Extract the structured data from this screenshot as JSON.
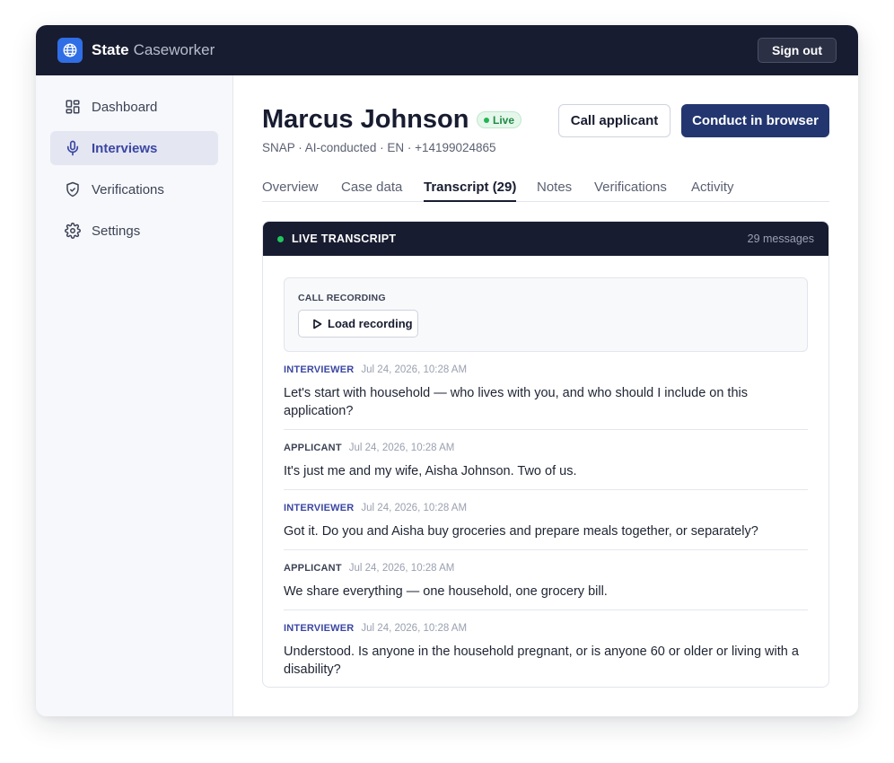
{
  "app": {
    "brand_bold": "State",
    "brand_light": "Caseworker",
    "sign_out": "Sign out"
  },
  "sidebar": {
    "items": [
      {
        "label": "Dashboard",
        "icon": "dashboard-icon",
        "active": false
      },
      {
        "label": "Interviews",
        "icon": "microphone-icon",
        "active": true
      },
      {
        "label": "Verifications",
        "icon": "shield-check-icon",
        "active": false
      },
      {
        "label": "Settings",
        "icon": "gear-icon",
        "active": false
      }
    ]
  },
  "applicant": {
    "name": "Marcus Johnson",
    "status": "Live",
    "details": "SNAP · AI-conducted · EN · +14199024865"
  },
  "actions": {
    "call": "Call applicant",
    "conduct": "Conduct in browser"
  },
  "tabs": [
    {
      "label": "Overview",
      "active": false
    },
    {
      "label": "Case data",
      "active": false
    },
    {
      "label": "Transcript (29)",
      "active": true
    },
    {
      "label": "Notes",
      "active": false
    },
    {
      "label": "Verifications",
      "active": false
    },
    {
      "label": "Activity",
      "active": false
    }
  ],
  "transcript": {
    "title": "LIVE TRANSCRIPT",
    "count": "29 messages",
    "recording_label": "CALL RECORDING",
    "load_recording": "Load recording",
    "messages": [
      {
        "role": "INTERVIEWER",
        "time": "Jul 24, 2026, 10:28 AM",
        "text": "Let's start with household — who lives with you, and who should I include on this application?"
      },
      {
        "role": "APPLICANT",
        "time": "Jul 24, 2026, 10:28 AM",
        "text": "It's just me and my wife, Aisha Johnson. Two of us."
      },
      {
        "role": "INTERVIEWER",
        "time": "Jul 24, 2026, 10:28 AM",
        "text": "Got it. Do you and Aisha buy groceries and prepare meals together, or separately?"
      },
      {
        "role": "APPLICANT",
        "time": "Jul 24, 2026, 10:28 AM",
        "text": "We share everything — one household, one grocery bill."
      },
      {
        "role": "INTERVIEWER",
        "time": "Jul 24, 2026, 10:28 AM",
        "text": "Understood. Is anyone in the household pregnant, or is anyone 60 or older or living with a disability?"
      }
    ]
  },
  "colors": {
    "topbar": "#181c30",
    "accent": "#3b47a3",
    "primary_button": "#233670",
    "live_green": "#22b455"
  }
}
